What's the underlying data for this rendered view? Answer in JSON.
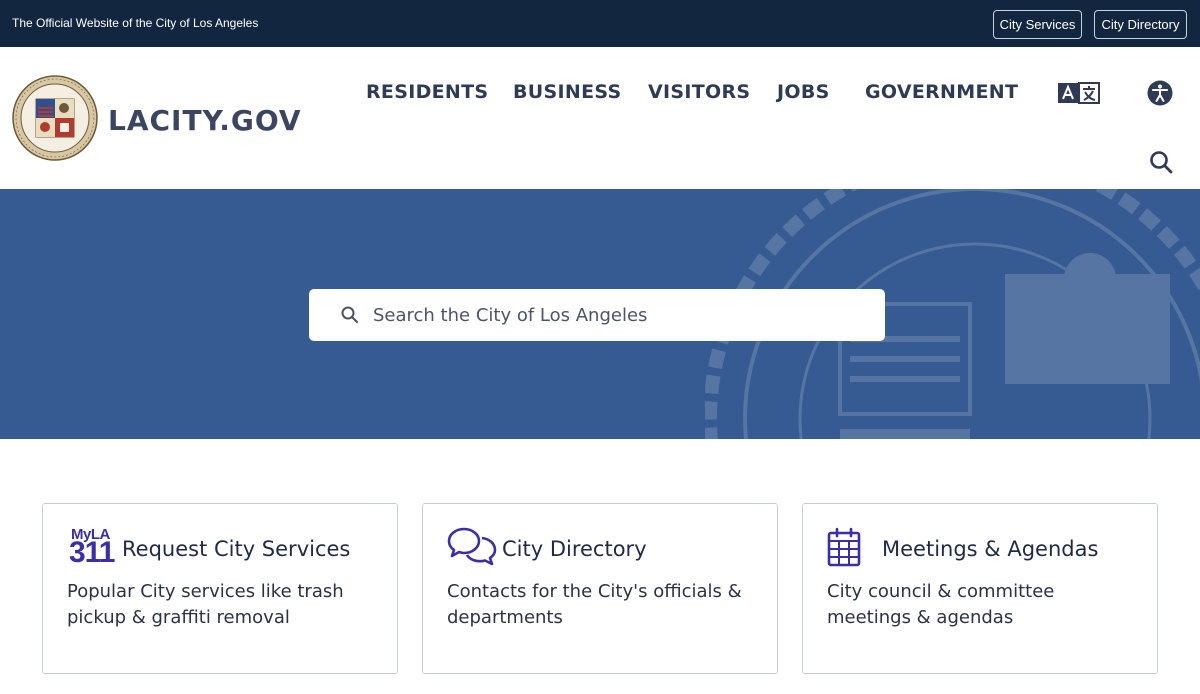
{
  "topbar": {
    "official_text": "The Official Website of the City of Los Angeles",
    "city_services_label": "City Services",
    "city_directory_label": "City Directory"
  },
  "header": {
    "site_name": "LACITY.GOV",
    "nav": [
      "RESIDENTS",
      "BUSINESS",
      "VISITORS",
      "JOBS",
      "GOVERNMENT"
    ],
    "icons": [
      "seal-logo",
      "translate-icon",
      "accessibility-icon",
      "search-icon"
    ]
  },
  "hero": {
    "search_placeholder": "Search the City of Los Angeles"
  },
  "cards": [
    {
      "logo_top": "MyLA",
      "logo_number": "311",
      "title": "Request City Services",
      "description": "Popular City services like trash pickup & graffiti removal"
    },
    {
      "title": "City Directory",
      "description": "Contacts for the City's officials & departments"
    },
    {
      "title": "Meetings & Agendas",
      "description": "City council & committee meetings & agendas"
    }
  ],
  "colors": {
    "topbar": "#13263f",
    "hero": "#355b92",
    "accent": "#3a2fa6",
    "nav_text": "#2f3a54"
  }
}
